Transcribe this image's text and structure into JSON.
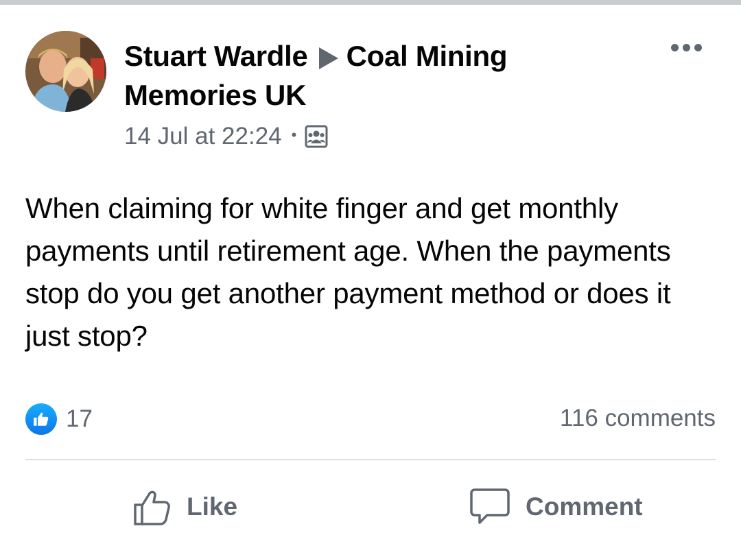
{
  "post": {
    "author": "Stuart Wardle",
    "group": "Coal Mining Memories UK",
    "timestamp": "14 Jul at 22:24",
    "separator": "•",
    "audience_icon": "group-members-icon",
    "text": "When claiming for white finger and get monthly payments until retirement age. When the payments stop do you get another payment method or does it just stop?"
  },
  "reactions": {
    "icon": "like-reaction-icon",
    "count": "17"
  },
  "comments": {
    "label": "116 comments"
  },
  "actions": {
    "like_label": "Like",
    "like_icon": "thumbs-up-icon",
    "comment_label": "Comment",
    "comment_icon": "speech-bubble-icon"
  },
  "menu": {
    "icon": "more-options-icon"
  },
  "colors": {
    "text_primary": "#050505",
    "text_secondary": "#606770",
    "like_blue": "#1877f2",
    "divider": "#dadde1"
  }
}
